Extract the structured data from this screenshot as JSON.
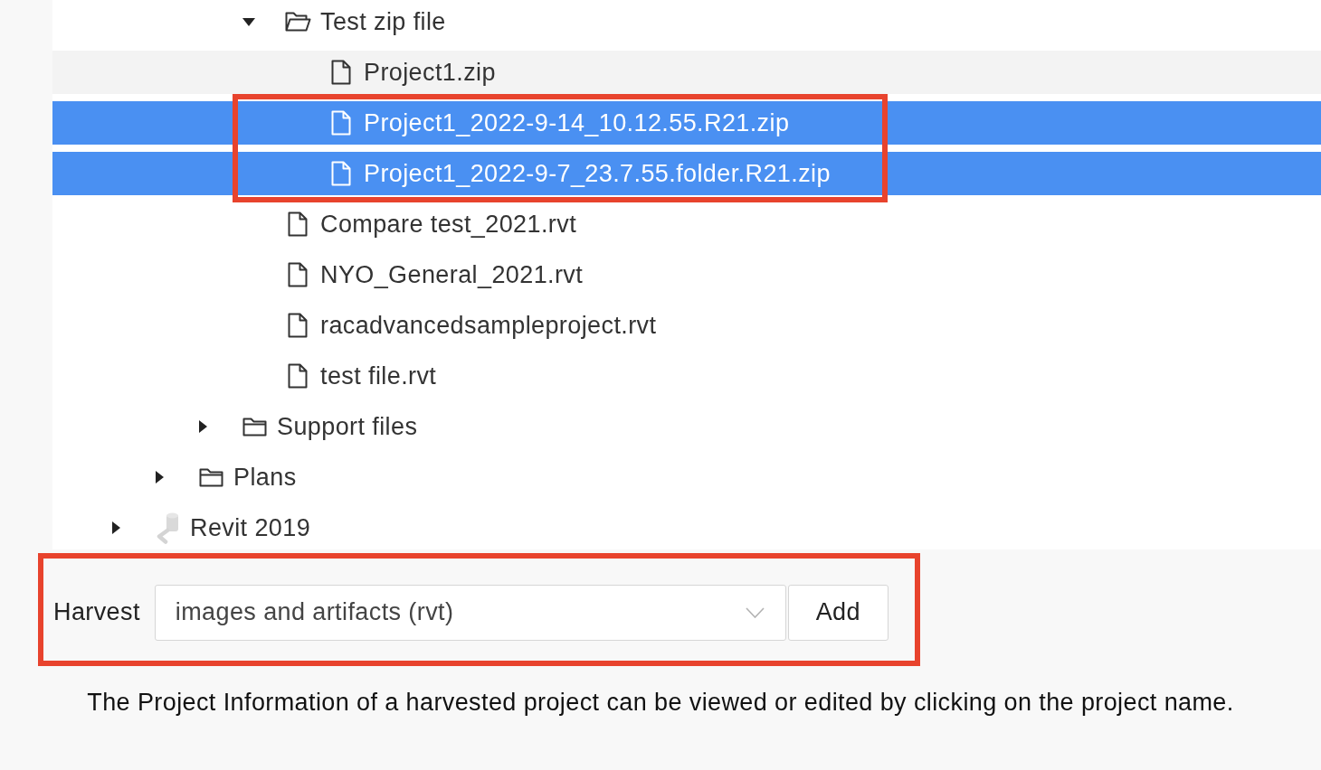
{
  "tree": {
    "items": [
      {
        "children": [
          {
            "children": [
              {
                "children": [
                  {
                    "label": "Test zip file",
                    "kind": "folder",
                    "expanded": true,
                    "selected": false,
                    "hovered": false,
                    "children": [
                      {
                        "label": "Project1.zip",
                        "kind": "file",
                        "selected": false,
                        "hovered": true,
                        "outlined": false
                      },
                      {
                        "label": "Project1_2022-9-14_10.12.55.R21.zip",
                        "kind": "file",
                        "selected": true,
                        "hovered": false,
                        "outlined": true
                      },
                      {
                        "label": "Project1_2022-9-7_23.7.55.folder.R21.zip",
                        "kind": "file",
                        "selected": true,
                        "hovered": false,
                        "outlined": true
                      }
                    ]
                  },
                  {
                    "label": "Compare test_2021.rvt",
                    "kind": "file",
                    "selected": false,
                    "hovered": false
                  },
                  {
                    "label": "NYO_General_2021.rvt",
                    "kind": "file",
                    "selected": false,
                    "hovered": false
                  },
                  {
                    "label": "racadvancedsampleproject.rvt",
                    "kind": "file",
                    "selected": false,
                    "hovered": false
                  },
                  {
                    "label": "test file.rvt",
                    "kind": "file",
                    "selected": false,
                    "hovered": false
                  }
                ]
              },
              {
                "label": "Support files",
                "kind": "folder",
                "expanded": false,
                "selected": false,
                "hovered": false
              }
            ]
          },
          {
            "label": "Plans",
            "kind": "folder",
            "expanded": false,
            "selected": false,
            "hovered": false
          }
        ]
      },
      {
        "label": "Revit 2019",
        "kind": "product",
        "expanded": false,
        "selected": false,
        "hovered": false
      }
    ]
  },
  "harvest": {
    "outlined": true,
    "label": "Harvest",
    "value": "images and artifacts (rvt)",
    "button": "Add"
  },
  "note": "The Project Information of a harvested project can be viewed or edited by clicking on the project name."
}
